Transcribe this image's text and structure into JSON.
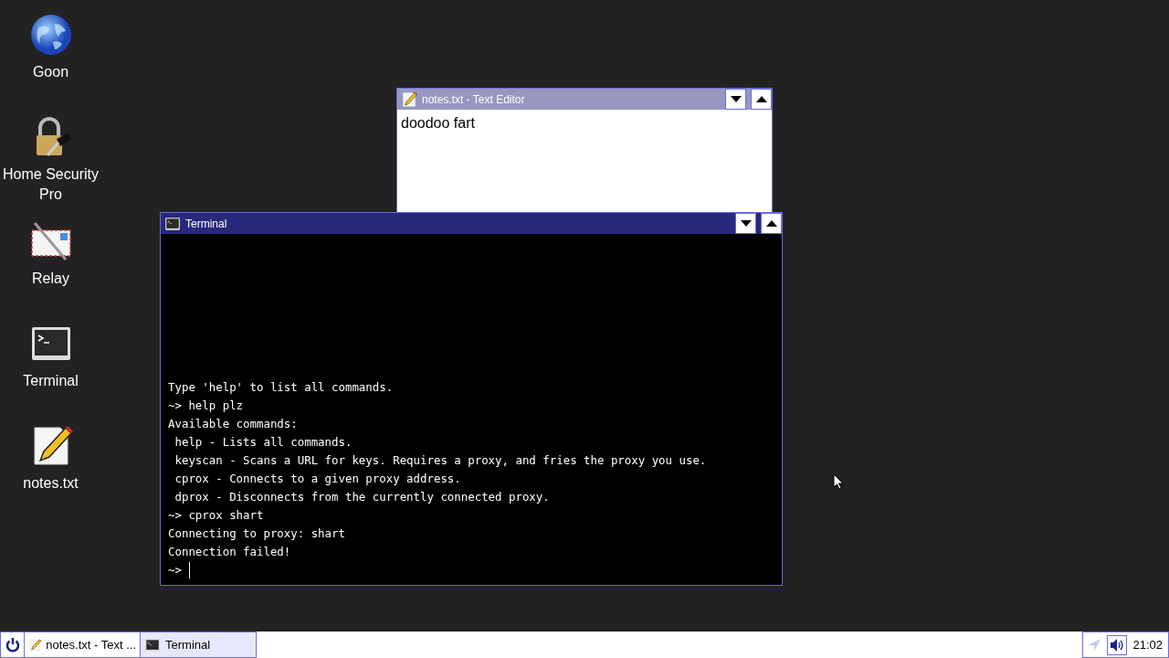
{
  "desktop_icons": [
    {
      "kind": "globe",
      "label": "Goon"
    },
    {
      "kind": "lock",
      "label": "Home Security Pro"
    },
    {
      "kind": "mail",
      "label": "Relay"
    },
    {
      "kind": "terminal",
      "label": "Terminal"
    },
    {
      "kind": "notes",
      "label": "notes.txt"
    }
  ],
  "windows": [
    {
      "kind": "editor",
      "title": "notes.txt - Text Editor",
      "active": false,
      "content": "doodoo fart"
    },
    {
      "kind": "terminal",
      "title": "Terminal",
      "active": true,
      "lines": [
        "Type 'help' to list all commands.",
        "~> help plz",
        "Available commands:",
        " help - Lists all commands.",
        " keyscan - Scans a URL for keys. Requires a proxy, and fries the proxy you use.",
        " cprox - Connects to a given proxy address.",
        " dprox - Disconnects from the currently connected proxy.",
        "~> cprox shart",
        "Connecting to proxy: shart",
        "Connection failed!"
      ],
      "prompt": "~>"
    }
  ],
  "taskbar": {
    "items": [
      {
        "kind": "notes",
        "label": "notes.txt - Text ...",
        "selected": false
      },
      {
        "kind": "terminal",
        "label": "Terminal",
        "selected": true
      }
    ],
    "clock": "21:02"
  }
}
